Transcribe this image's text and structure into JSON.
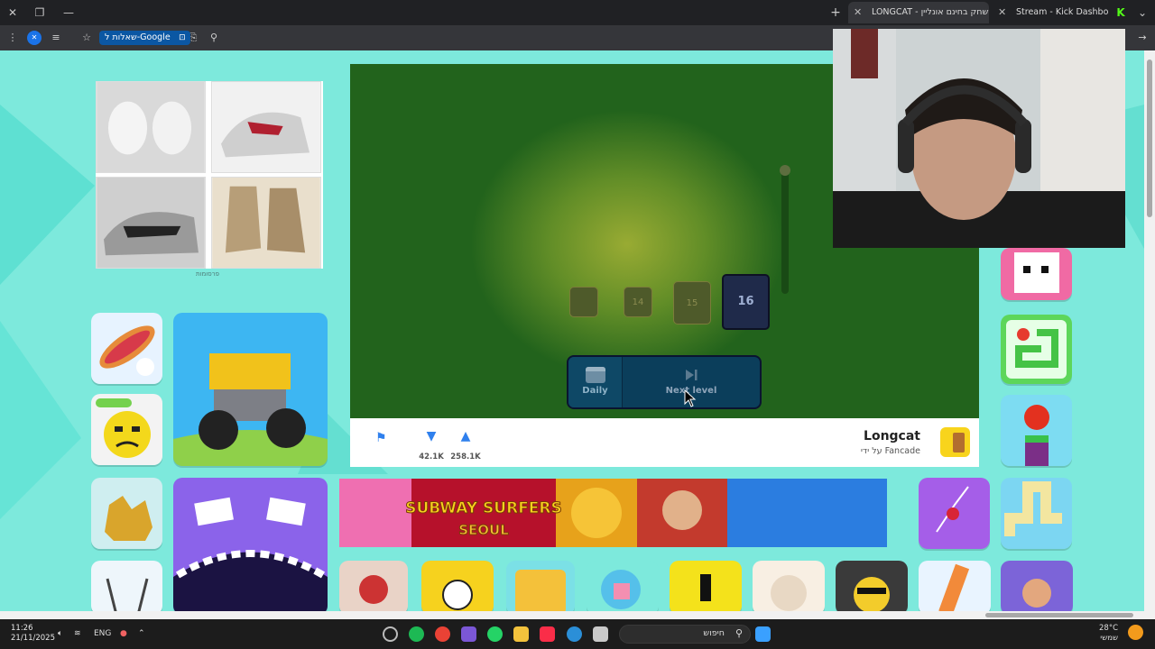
{
  "browser": {
    "tabs": [
      {
        "title": "LONGCAT - משחק בחינם אונליין",
        "active": true
      },
      {
        "title": "Stream - Kick Dashboard",
        "active": false
      }
    ],
    "google_chip": "שאלות ל-Google"
  },
  "ad": {
    "label": "פרסומות"
  },
  "game": {
    "levels": [
      "14",
      "15",
      "16"
    ],
    "current_level": "16",
    "daily_label": "Daily",
    "next_level_label": "Next level"
  },
  "info": {
    "title": "Longcat",
    "by_line": "על ידי Fancade",
    "dislikes": "42.1K",
    "likes": "258.1K"
  },
  "banner": {
    "game": "SUBWAY SURFERS",
    "sub": "SEOUL"
  },
  "taskbar": {
    "time": "11:26",
    "date": "21/11/2025",
    "lang": "ENG",
    "search_placeholder": "חיפוש",
    "temp": "28°C",
    "weather": "שמשי"
  },
  "colors": {
    "page_bg": "#7de9dc",
    "game_bg": "#22631c",
    "accent": "#2f80ed"
  }
}
